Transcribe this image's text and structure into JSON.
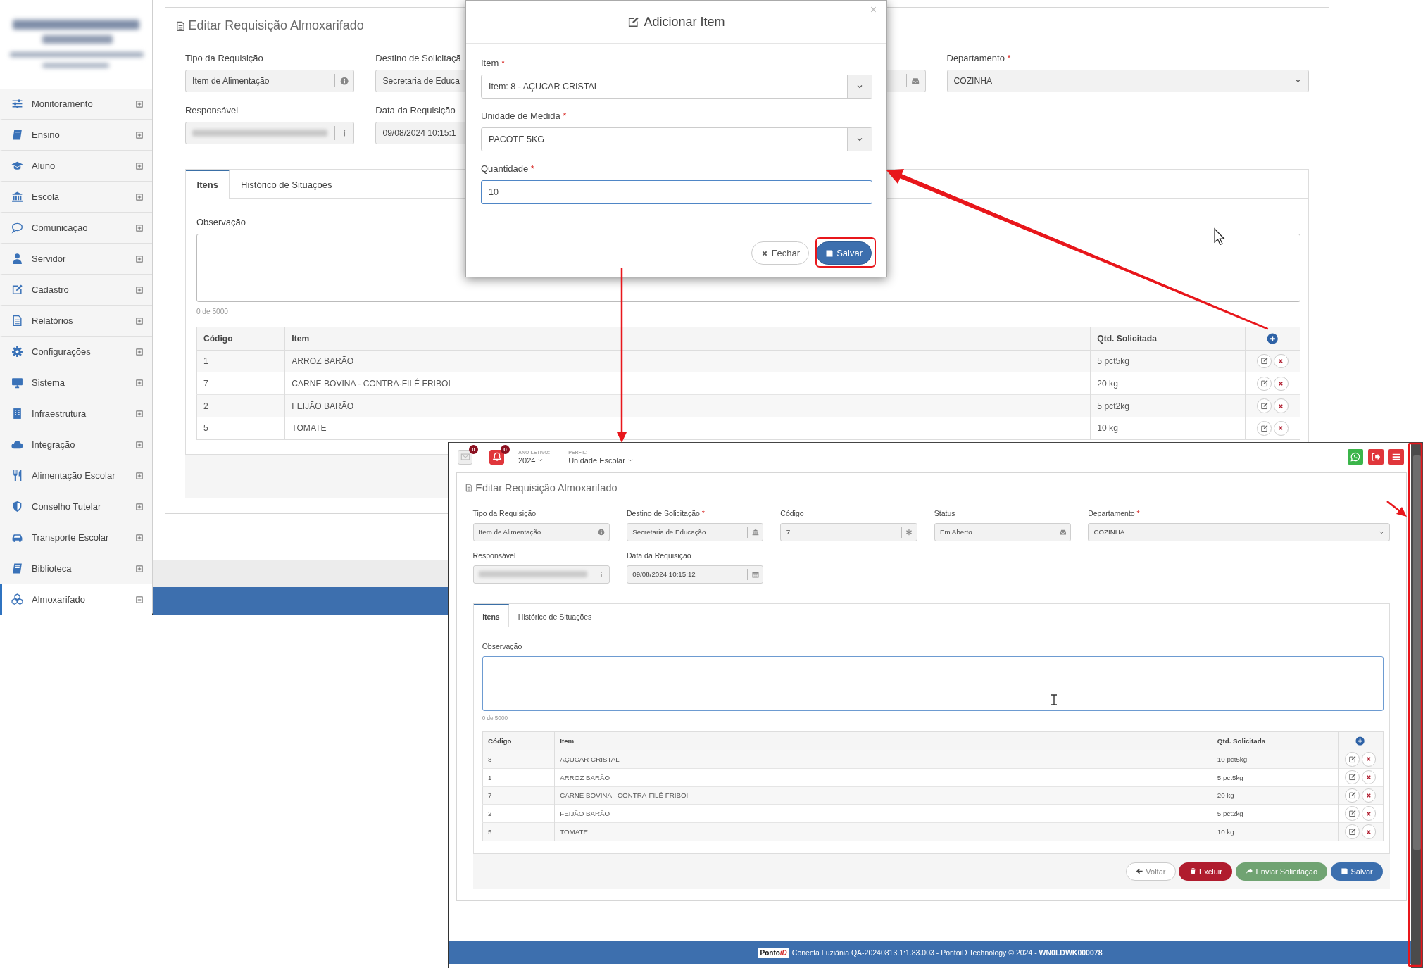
{
  "sidebar": {
    "items": [
      {
        "label": "Monitoramento",
        "selected": false,
        "expanded": false
      },
      {
        "label": "Ensino",
        "selected": false,
        "expanded": false
      },
      {
        "label": "Aluno",
        "selected": false,
        "expanded": false
      },
      {
        "label": "Escola",
        "selected": false,
        "expanded": false
      },
      {
        "label": "Comunicação",
        "selected": false,
        "expanded": false
      },
      {
        "label": "Servidor",
        "selected": false,
        "expanded": false
      },
      {
        "label": "Cadastro",
        "selected": false,
        "expanded": false
      },
      {
        "label": "Relatórios",
        "selected": false,
        "expanded": false
      },
      {
        "label": "Configurações",
        "selected": false,
        "expanded": false
      },
      {
        "label": "Sistema",
        "selected": false,
        "expanded": false
      },
      {
        "label": "Infraestrutura",
        "selected": false,
        "expanded": false
      },
      {
        "label": "Integração",
        "selected": false,
        "expanded": false
      },
      {
        "label": "Alimentação Escolar",
        "selected": false,
        "expanded": false
      },
      {
        "label": "Conselho Tutelar",
        "selected": false,
        "expanded": false
      },
      {
        "label": "Transporte Escolar",
        "selected": false,
        "expanded": false
      },
      {
        "label": "Biblioteca",
        "selected": false,
        "expanded": false
      },
      {
        "label": "Almoxarifado",
        "selected": true,
        "expanded": true
      }
    ]
  },
  "screen_a": {
    "title": "Editar Requisição Almoxarifado",
    "field_rows": [
      [
        {
          "kind": "input",
          "label": "Tipo da Requisição",
          "value": "Item de Alimentação",
          "redacted": false
        },
        {
          "kind": "input",
          "label": "Destino de Solicitaçã",
          "value": "Secretaria de Educa",
          "redacted": false
        },
        {
          "kind": "input"
        },
        {
          "kind": "select",
          "label": "Departamento",
          "required_mark": "*",
          "value": "COZINHA"
        }
      ],
      [
        {
          "kind": "input",
          "label": "Responsável",
          "redacted": true
        },
        {
          "kind": "input",
          "label": "Data da Requisição",
          "value": "09/08/2024 10:15:1",
          "redacted": false
        }
      ]
    ],
    "tabs": [
      {
        "label": "Itens",
        "selected": true
      },
      {
        "label": "Histórico de Situações",
        "selected": false
      }
    ],
    "observation": {
      "label": "Observação",
      "counter": "0 de 5000",
      "focused": false
    },
    "table": {
      "columns": [
        "Código",
        "Item",
        "Qtd. Solicitada"
      ],
      "rows": [
        {
          "cells": [
            "1",
            "ARROZ BARÃO",
            "5 pct5kg"
          ]
        },
        {
          "cells": [
            "7",
            "CARNE BOVINA - CONTRA-FILÉ FRIBOI",
            "20 kg"
          ]
        },
        {
          "cells": [
            "2",
            "FEIJÃO BARÃO",
            "5 pct2kg"
          ]
        },
        {
          "cells": [
            "5",
            "TOMATE",
            "10 kg"
          ]
        }
      ]
    }
  },
  "modal": {
    "title": "Adicionar Item",
    "close": "×",
    "fields": [
      {
        "kind": "select",
        "label": "Item",
        "required_mark": "*",
        "value": "Item: 8 - AÇUCAR CRISTAL",
        "focused": false
      },
      {
        "kind": "select",
        "label": "Unidade de Medida",
        "required_mark": "*",
        "value": "PACOTE 5KG",
        "focused": false
      },
      {
        "kind": "input",
        "label": "Quantidade",
        "required_mark": "*",
        "value": "10",
        "focused": true
      }
    ],
    "buttons": [
      {
        "label": "Fechar",
        "kind": "default"
      },
      {
        "label": "Salvar",
        "kind": "primary"
      }
    ]
  },
  "screen_b": {
    "top_bar": {
      "notifications": [
        {
          "count": "0"
        },
        {
          "count": "0"
        }
      ],
      "school_year": {
        "label": "ANO LETIVO:",
        "value": "2024"
      },
      "profile": {
        "label": "PERFIL:",
        "value": "Unidade Escolar"
      }
    },
    "title": "Editar Requisição Almoxarifado",
    "field_rows": [
      [
        {
          "kind": "input",
          "label": "Tipo da Requisição",
          "value": "Item de Alimentação",
          "redacted": false
        },
        {
          "kind": "input",
          "label": "Destino de Solicitação",
          "required_mark": "*",
          "value": "Secretaria de Educação",
          "redacted": false
        },
        {
          "kind": "input",
          "label": "Código",
          "value": "7",
          "redacted": false
        },
        {
          "kind": "input",
          "label": "Status",
          "value": "Em Aberto",
          "redacted": false
        },
        {
          "kind": "select",
          "label": "Departamento",
          "required_mark": "*",
          "value": "COZINHA"
        }
      ],
      [
        {
          "kind": "input",
          "label": "Responsável",
          "redacted": true
        },
        {
          "kind": "input",
          "label": "Data da Requisição",
          "value": "09/08/2024 10:15:12",
          "redacted": false
        }
      ]
    ],
    "tabs": [
      {
        "label": "Itens",
        "selected": true
      },
      {
        "label": "Histórico de Situações",
        "selected": false
      }
    ],
    "observation": {
      "label": "Observação",
      "counter": "0 de 5000",
      "focused": true
    },
    "table": {
      "columns": [
        "Código",
        "Item",
        "Qtd. Solicitada"
      ],
      "rows": [
        {
          "cells": [
            "8",
            "AÇUCAR CRISTAL",
            "10 pct5kg"
          ]
        },
        {
          "cells": [
            "1",
            "ARROZ BARÃO",
            "5 pct5kg"
          ]
        },
        {
          "cells": [
            "7",
            "CARNE BOVINA - CONTRA-FILÉ FRIBOI",
            "20 kg"
          ]
        },
        {
          "cells": [
            "2",
            "FEIJÃO BARÃO",
            "5 pct2kg"
          ]
        },
        {
          "cells": [
            "5",
            "TOMATE",
            "10 kg"
          ]
        }
      ]
    },
    "buttons": [
      {
        "label": "Voltar",
        "kind": "light"
      },
      {
        "label": "Excluir",
        "kind": "danger"
      },
      {
        "label": "Enviar Solicitação",
        "kind": "success"
      },
      {
        "label": "Salvar",
        "kind": "primary"
      }
    ],
    "footer": {
      "logo_parts": [
        {
          "text": "Ponto",
          "kind": "plain"
        },
        {
          "text": "iD",
          "kind": "accent"
        }
      ],
      "text": "Conecta Luziânia QA-20240813.1:1.83.003 - PontoiD Technology © 2024 - **WN0LDWK000078**"
    }
  }
}
